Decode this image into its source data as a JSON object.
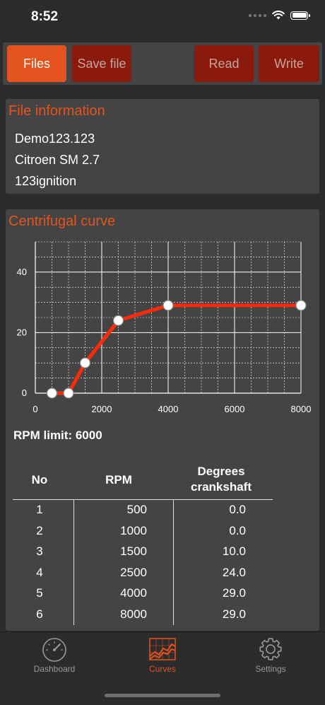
{
  "status": {
    "time": "8:52"
  },
  "toolbar": {
    "files": "Files",
    "save_file": "Save file",
    "read": "Read",
    "write": "Write"
  },
  "file_info": {
    "title": "File information",
    "lines": [
      "Demo123.123",
      "Citroen SM 2.7",
      "123ignition"
    ]
  },
  "curve": {
    "title": "Centrifugal curve",
    "rpm_limit": "RPM limit: 6000",
    "table": {
      "headers": {
        "no": "No",
        "rpm": "RPM",
        "degrees_line1": "Degrees",
        "degrees_line2": "crankshaft"
      },
      "rows": [
        {
          "no": "1",
          "rpm": "500",
          "deg": "0.0"
        },
        {
          "no": "2",
          "rpm": "1000",
          "deg": "0.0"
        },
        {
          "no": "3",
          "rpm": "1500",
          "deg": "10.0"
        },
        {
          "no": "4",
          "rpm": "2500",
          "deg": "24.0"
        },
        {
          "no": "5",
          "rpm": "4000",
          "deg": "29.0"
        },
        {
          "no": "6",
          "rpm": "8000",
          "deg": "29.0"
        }
      ]
    }
  },
  "chart_data": {
    "type": "line",
    "x": [
      500,
      1000,
      1500,
      2500,
      4000,
      8000
    ],
    "values": [
      0,
      0,
      10,
      24,
      29,
      29
    ],
    "xlim": [
      0,
      8000
    ],
    "ylim": [
      0,
      50
    ],
    "xticks": [
      "0",
      "2000",
      "4000",
      "6000",
      "8000"
    ],
    "yticks": [
      "0",
      "20",
      "40"
    ],
    "grid": true,
    "line_color": "#ff2a0a",
    "marker_color": "#ffffff"
  },
  "tabs": {
    "dashboard": "Dashboard",
    "curves": "Curves",
    "settings": "Settings"
  },
  "colors": {
    "accent": "#e4531e",
    "button_dark": "#8a1a0c",
    "panel": "#444444",
    "background": "#2c2c2c"
  }
}
